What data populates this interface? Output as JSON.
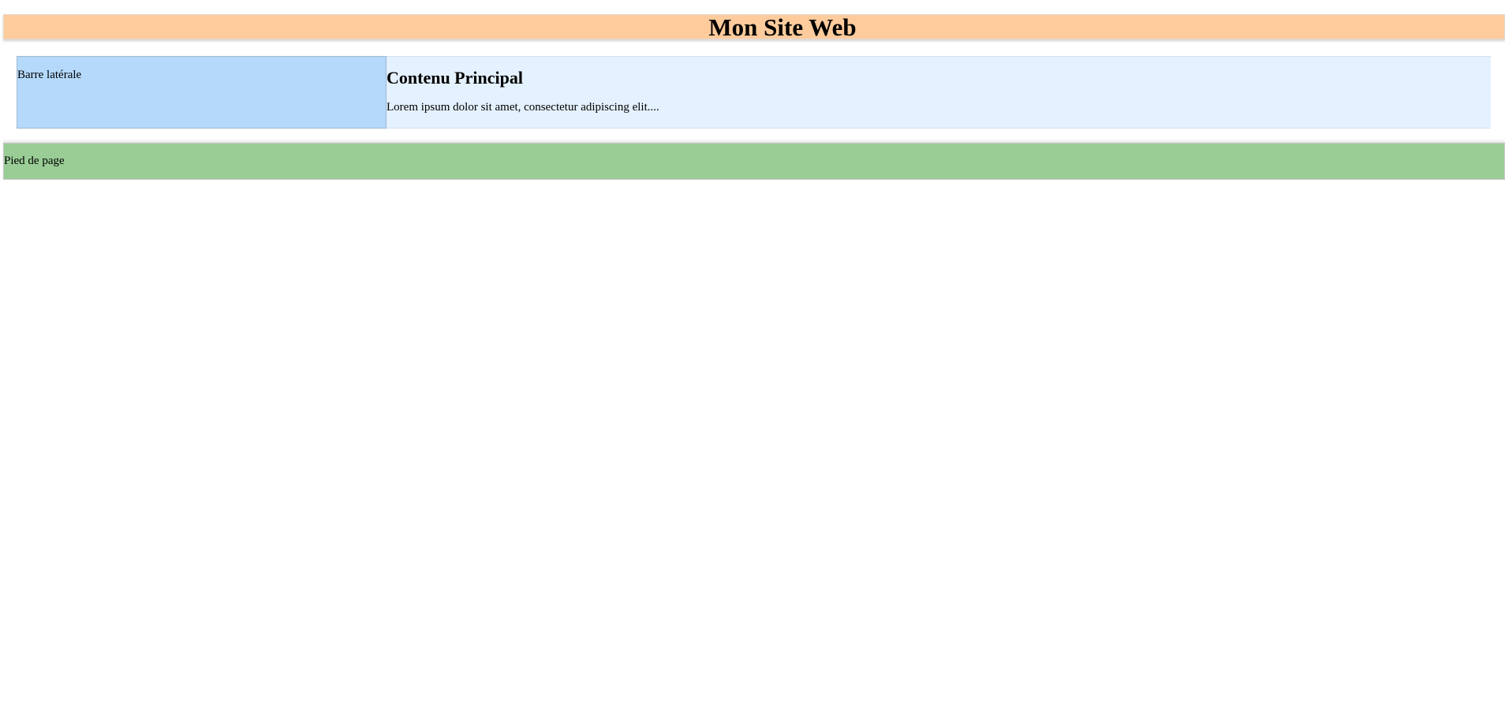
{
  "header": {
    "title": "Mon Site Web"
  },
  "sidebar": {
    "label": "Barre latérale"
  },
  "main": {
    "title": "Contenu Principal",
    "text": "Lorem ipsum dolor sit amet, consectetur adipiscing elit...."
  },
  "footer": {
    "label": "Pied de page"
  },
  "colors": {
    "header_bg": "#fecb9c",
    "sidebar_bg": "#b4d9fb",
    "main_bg": "#e4f1fe",
    "footer_bg": "#9acd96"
  }
}
